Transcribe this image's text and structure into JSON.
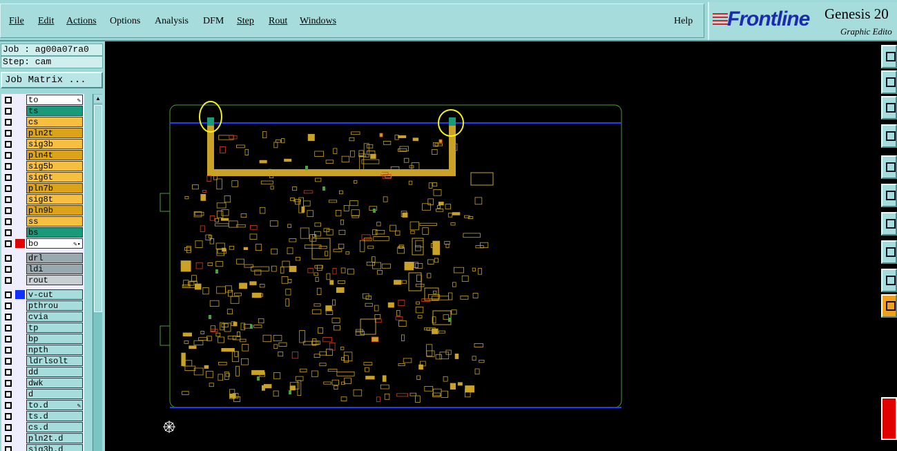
{
  "menubar": {
    "items": [
      {
        "label": "File",
        "underline": "F"
      },
      {
        "label": "Edit",
        "underline": "E"
      },
      {
        "label": "Actions",
        "underline": "A"
      },
      {
        "label": "Options",
        "underline": ""
      },
      {
        "label": "Analysis",
        "underline": ""
      },
      {
        "label": "DFM",
        "underline": ""
      },
      {
        "label": "Step",
        "underline": "S"
      },
      {
        "label": "Rout",
        "underline": "R"
      },
      {
        "label": "Windows",
        "underline": "W"
      }
    ],
    "help": "Help"
  },
  "branding": {
    "logo": "Frontline",
    "app_name": "Genesis 20",
    "subtitle": "Graphic Edito"
  },
  "job_info": {
    "job_line": "Job : ag00a07ra0",
    "step_line": "Step: cam",
    "job_matrix_button": "Job Matrix ..."
  },
  "layers": [
    {
      "name": "to",
      "color": "#ffffff",
      "flag": "✎",
      "swatch": ""
    },
    {
      "name": "ts",
      "color": "#1a9a78",
      "flag": "",
      "swatch": ""
    },
    {
      "name": "cs",
      "color": "#f5c040",
      "flag": "",
      "swatch": ""
    },
    {
      "name": "pln2t",
      "color": "#d9a41a",
      "flag": "",
      "swatch": ""
    },
    {
      "name": "sig3b",
      "color": "#f5c040",
      "flag": "",
      "swatch": ""
    },
    {
      "name": "pln4t",
      "color": "#d9a41a",
      "flag": "",
      "swatch": ""
    },
    {
      "name": "sig5b",
      "color": "#f5c040",
      "flag": "",
      "swatch": ""
    },
    {
      "name": "sig6t",
      "color": "#f5c040",
      "flag": "",
      "swatch": ""
    },
    {
      "name": "pln7b",
      "color": "#d9a41a",
      "flag": "",
      "swatch": ""
    },
    {
      "name": "sig8t",
      "color": "#f5c040",
      "flag": "",
      "swatch": ""
    },
    {
      "name": "pln9b",
      "color": "#d9a41a",
      "flag": "",
      "swatch": ""
    },
    {
      "name": "ss",
      "color": "#f5c040",
      "flag": "",
      "swatch": ""
    },
    {
      "name": "bs",
      "color": "#1a9a78",
      "flag": "",
      "swatch": ""
    },
    {
      "name": "bo",
      "color": "#ffffff",
      "flag": "✎▪",
      "swatch": "#e00000",
      "gap_after": true
    },
    {
      "name": "drl",
      "color": "#9aa8b0",
      "flag": "",
      "swatch": ""
    },
    {
      "name": "ldi",
      "color": "#9aa8b0",
      "flag": "",
      "swatch": ""
    },
    {
      "name": "rout",
      "color": "#c8d0d4",
      "flag": "",
      "swatch": "",
      "gap_after": true
    },
    {
      "name": "v-cut",
      "color": "#a6dcdc",
      "flag": "",
      "swatch": "#1030ff"
    },
    {
      "name": "pthrou",
      "color": "#a6dcdc",
      "flag": "",
      "swatch": ""
    },
    {
      "name": "cvia",
      "color": "#a6dcdc",
      "flag": "",
      "swatch": ""
    },
    {
      "name": "tp",
      "color": "#a6dcdc",
      "flag": "",
      "swatch": ""
    },
    {
      "name": "bp",
      "color": "#a6dcdc",
      "flag": "",
      "swatch": ""
    },
    {
      "name": "npth",
      "color": "#a6dcdc",
      "flag": "",
      "swatch": ""
    },
    {
      "name": "ldrlsolt",
      "color": "#a6dcdc",
      "flag": "",
      "swatch": ""
    },
    {
      "name": "dd",
      "color": "#a6dcdc",
      "flag": "",
      "swatch": ""
    },
    {
      "name": "dwk",
      "color": "#a6dcdc",
      "flag": "",
      "swatch": ""
    },
    {
      "name": "d",
      "color": "#a6dcdc",
      "flag": "",
      "swatch": ""
    },
    {
      "name": "to.d",
      "color": "#a6dcdc",
      "flag": "✎",
      "swatch": ""
    },
    {
      "name": "ts.d",
      "color": "#a6dcdc",
      "flag": "",
      "swatch": ""
    },
    {
      "name": "cs.d",
      "color": "#a6dcdc",
      "flag": "",
      "swatch": ""
    },
    {
      "name": "pln2t.d",
      "color": "#a6dcdc",
      "flag": "",
      "swatch": ""
    },
    {
      "name": "sig3b.d",
      "color": "#a6dcdc",
      "flag": "",
      "swatch": ""
    }
  ],
  "board": {
    "trace_color": "#c9a227",
    "outline_color": "#4f9a3a",
    "vcut_color": "#1f3cff",
    "highlight_color": "#f2f21a",
    "component_color": "#c9a227"
  }
}
